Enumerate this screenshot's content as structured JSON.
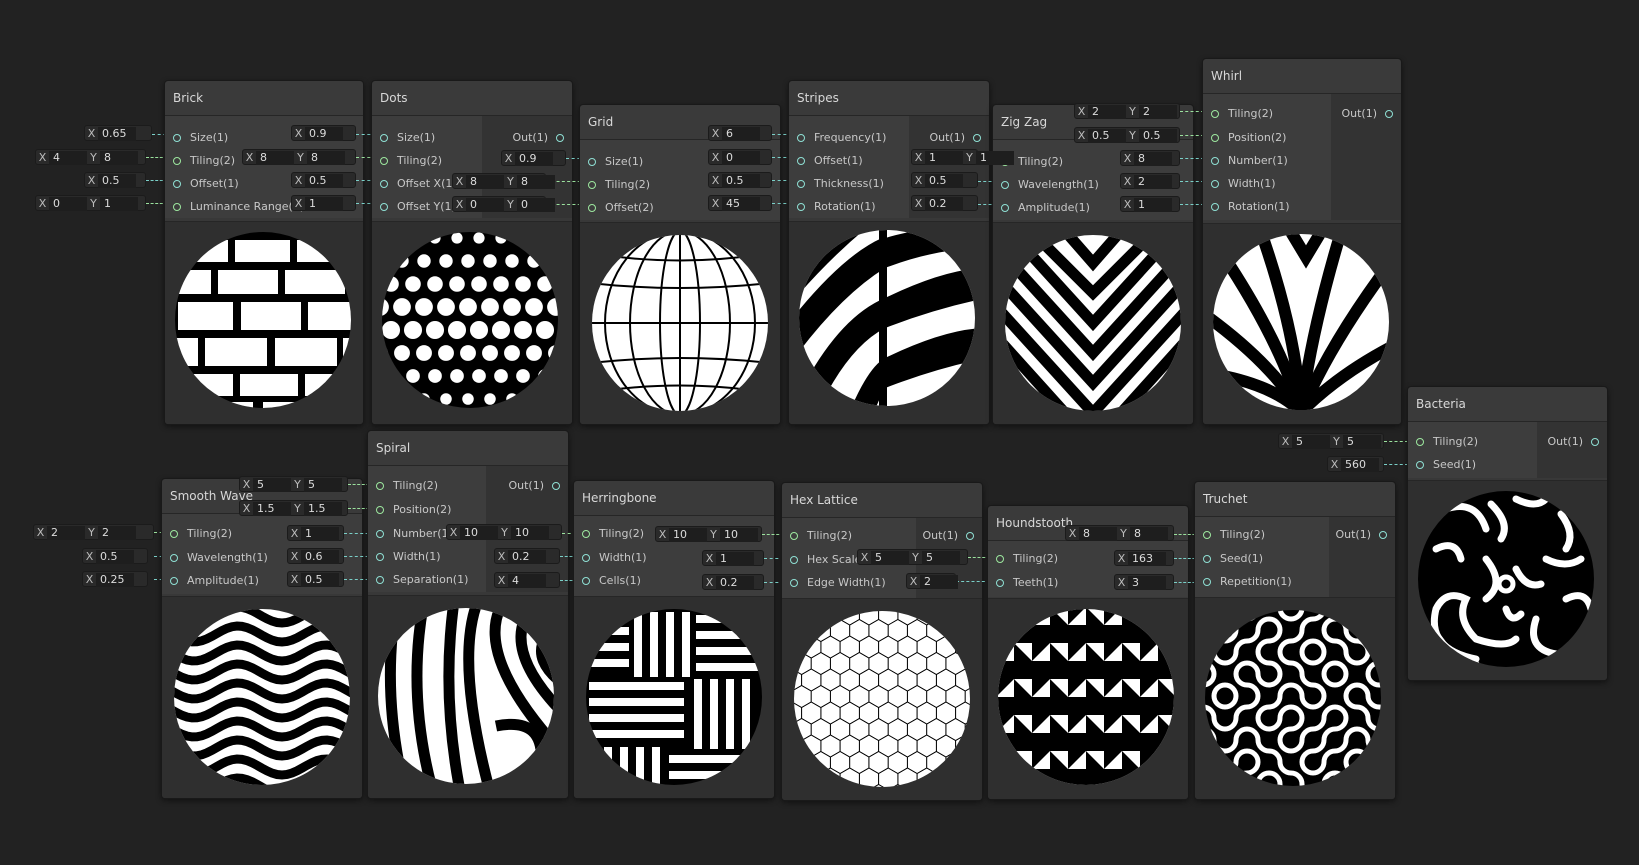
{
  "nodes": {
    "brick": {
      "title": "Brick",
      "inputs": [
        "Size(1)",
        "Tiling(2)",
        "Offset(1)",
        "Luminance Range(2)"
      ],
      "fields": {
        "size": "0.65",
        "tiling_x": "4",
        "tiling_y": "8",
        "offset": "0.5",
        "lum_x": "0",
        "lum_y": "1"
      }
    },
    "dots": {
      "title": "Dots",
      "output": "Out(1)",
      "inputs": [
        "Size(1)",
        "Tiling(2)",
        "Offset X(1)",
        "Offset Y(1)"
      ],
      "fields": {
        "size": "0.9",
        "tiling_x": "8",
        "tiling_y": "8",
        "offset_x": "0.5",
        "offset_y": "1"
      }
    },
    "grid": {
      "title": "Grid",
      "inputs": [
        "Size(1)",
        "Tiling(2)",
        "Offset(2)"
      ],
      "fields": {
        "size": "0.9",
        "tiling_x": "8",
        "tiling_y": "8",
        "offset_x": "0",
        "offset_y": "0"
      }
    },
    "stripes": {
      "title": "Stripes",
      "output": "Out(1)",
      "inputs": [
        "Frequency(1)",
        "Offset(1)",
        "Thickness(1)",
        "Rotation(1)"
      ],
      "fields": {
        "frequency": "6",
        "offset": "0",
        "thickness": "0.5",
        "rotation": "45"
      }
    },
    "zigzag": {
      "title": "Zig Zag",
      "inputs": [
        "Tiling(2)",
        "Wavelength(1)",
        "Amplitude(1)"
      ],
      "fields": {
        "tiling_x": "1",
        "tiling_y": "1",
        "wavelength": "0.5",
        "amplitude": "0.2"
      }
    },
    "whirl": {
      "title": "Whirl",
      "output": "Out(1)",
      "inputs": [
        "Tiling(2)",
        "Position(2)",
        "Number(1)",
        "Width(1)",
        "Rotation(1)"
      ],
      "fields": {
        "tiling_x": "2",
        "tiling_y": "2",
        "pos_x": "0.5",
        "pos_y": "0.5",
        "number": "8",
        "width": "2",
        "rotation": "1"
      }
    },
    "bacteria": {
      "title": "Bacteria",
      "output": "Out(1)",
      "inputs": [
        "Tiling(2)",
        "Seed(1)"
      ],
      "fields": {
        "tiling_x": "5",
        "tiling_y": "5",
        "seed": "560"
      }
    },
    "smoothwave": {
      "title": "Smooth Wave",
      "inputs": [
        "Tiling(2)",
        "Wavelength(1)",
        "Amplitude(1)"
      ],
      "fields": {
        "tiling_x": "2",
        "tiling_y": "2",
        "wavelength": "0.5",
        "amplitude": "0.25"
      }
    },
    "spiral": {
      "title": "Spiral",
      "output": "Out(1)",
      "inputs": [
        "Tiling(2)",
        "Position(2)",
        "Number(1)",
        "Width(1)",
        "Separation(1)"
      ],
      "fields": {
        "tiling_x": "5",
        "tiling_y": "5",
        "pos_x": "1.5",
        "pos_y": "1.5",
        "number": "1",
        "width": "0.6",
        "separation": "0.5"
      }
    },
    "herringbone": {
      "title": "Herringbone",
      "inputs": [
        "Tiling(2)",
        "Width(1)",
        "Cells(1)"
      ],
      "fields": {
        "tiling_x": "10",
        "tiling_y": "10",
        "width": "0.2",
        "cells": "4"
      }
    },
    "hexlattice": {
      "title": "Hex Lattice",
      "output": "Out(1)",
      "inputs": [
        "Tiling(2)",
        "Hex Scale(1)",
        "Edge Width(1)"
      ],
      "fields": {
        "tiling_x": "10",
        "tiling_y": "10",
        "hex_scale": "1",
        "edge_width": "0.2"
      }
    },
    "houndstooth": {
      "title": "Houndstooth",
      "inputs": [
        "Tiling(2)",
        "Teeth(1)"
      ],
      "fields": {
        "tiling_x": "5",
        "tiling_y": "5",
        "teeth": "2"
      }
    },
    "truchet": {
      "title": "Truchet",
      "output": "Out(1)",
      "inputs": [
        "Tiling(2)",
        "Seed(1)",
        "Repetition(1)"
      ],
      "fields": {
        "tiling_x": "8",
        "tiling_y": "8",
        "seed": "163",
        "repetition": "3"
      }
    }
  },
  "axis": {
    "x": "X",
    "y": "Y"
  },
  "colors": {
    "canvas": "#222222",
    "node": "#383838",
    "port": "#8fe0d4",
    "port_vec": "#9de89f"
  }
}
